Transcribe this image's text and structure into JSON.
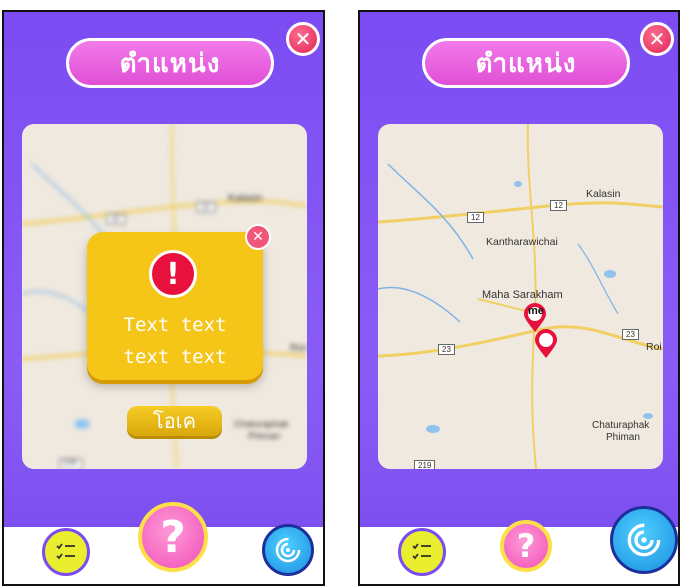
{
  "screens": [
    {
      "title": "ตำแหน่ง",
      "close_icon": "close-icon",
      "map_labels": {
        "kalasin": "Kalasin",
        "road12a": "12",
        "road12b": "12",
        "roi": "Roi E",
        "chaturaphak": "Chaturaphak",
        "phiman": "Phiman",
        "road219": "219"
      },
      "dialog": {
        "icon": "exclamation-icon",
        "line1": "Text text",
        "line2": "text text",
        "close_icon": "close-icon"
      },
      "ok_button": "โอเค",
      "bottom_nav": [
        "checklist-icon",
        "help-icon",
        "radar-icon"
      ],
      "help_symbol": "?"
    },
    {
      "title": "ตำแหน่ง",
      "close_icon": "close-icon",
      "map_labels": {
        "kalasin": "Kalasin",
        "road12a": "12",
        "road12b": "12",
        "kantharawichai": "Kantharawichai",
        "maha_sarakham": "Maha Sarakham",
        "me": "me",
        "road23a": "23",
        "road23b": "23",
        "roi": "Roi E",
        "chaturaphak": "Chaturaphak",
        "phiman": "Phiman",
        "road219": "219"
      },
      "bottom_nav": [
        "checklist-icon",
        "help-icon",
        "radar-icon"
      ],
      "help_symbol": "?"
    }
  ],
  "colors": {
    "purple": "#7b4cf2",
    "pink": "#e04fd6",
    "yellow": "#f5c518",
    "red": "#e8103c",
    "blue": "#1a8fe0"
  }
}
